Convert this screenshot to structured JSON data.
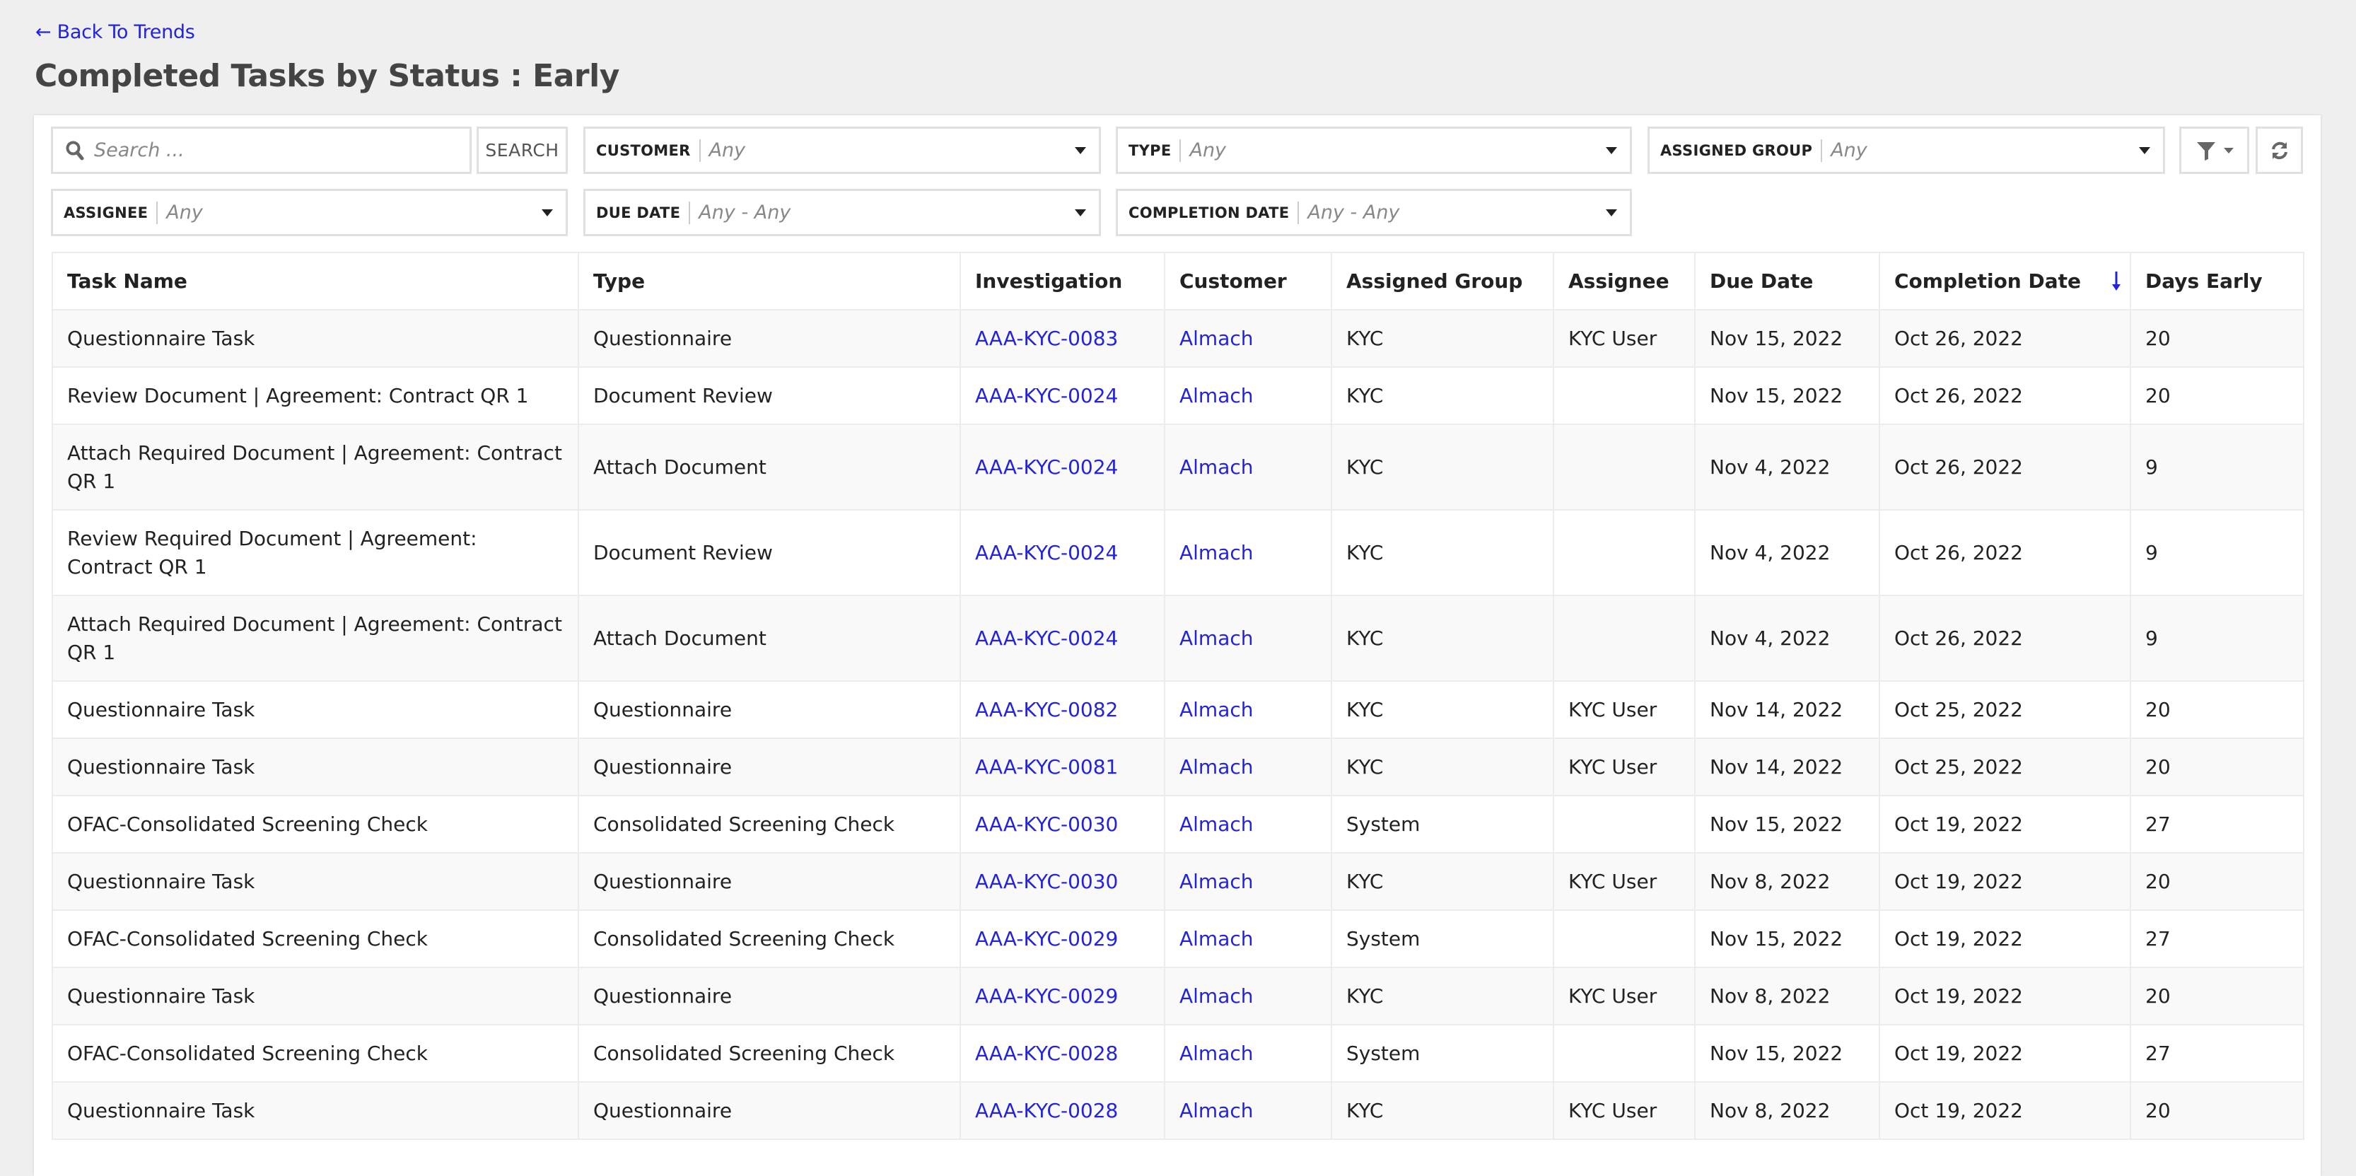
{
  "nav": {
    "back_link": "← Back To Trends"
  },
  "page": {
    "title": "Completed Tasks by Status : Early"
  },
  "filters": {
    "search": {
      "placeholder": "Search ...",
      "value": "",
      "button_label": "SEARCH",
      "icon": "search-icon"
    },
    "customer": {
      "label": "CUSTOMER",
      "value": "Any"
    },
    "type": {
      "label": "TYPE",
      "value": "Any"
    },
    "assigned_group": {
      "label": "ASSIGNED GROUP",
      "value": "Any"
    },
    "assignee": {
      "label": "ASSIGNEE",
      "value": "Any"
    },
    "due_date": {
      "label": "DUE DATE",
      "value": "Any - Any"
    },
    "completion_date": {
      "label": "COMPLETION DATE",
      "value": "Any - Any"
    },
    "filter_button_icon": "filter-icon",
    "refresh_button_icon": "refresh-icon"
  },
  "table": {
    "sorted_column": "Completion Date",
    "sort_direction": "descending",
    "columns": [
      "Task Name",
      "Type",
      "Investigation",
      "Customer",
      "Assigned Group",
      "Assignee",
      "Due Date",
      "Completion Date",
      "Days Early"
    ],
    "rows": [
      {
        "task_name": "Questionnaire Task",
        "type": "Questionnaire",
        "investigation": "AAA-KYC-0083",
        "customer": "Almach",
        "assigned_group": "KYC",
        "assignee": "KYC User",
        "due_date": "Nov 15, 2022",
        "completion_date": "Oct 26, 2022",
        "days_early": "20"
      },
      {
        "task_name": "Review Document | Agreement: Contract QR 1",
        "type": "Document Review",
        "investigation": "AAA-KYC-0024",
        "customer": "Almach",
        "assigned_group": "KYC",
        "assignee": "",
        "due_date": "Nov 15, 2022",
        "completion_date": "Oct 26, 2022",
        "days_early": "20"
      },
      {
        "task_name": "Attach Required Document | Agreement: Contract QR 1",
        "type": "Attach Document",
        "investigation": "AAA-KYC-0024",
        "customer": "Almach",
        "assigned_group": "KYC",
        "assignee": "",
        "due_date": "Nov 4, 2022",
        "completion_date": "Oct 26, 2022",
        "days_early": "9"
      },
      {
        "task_name": "Review Required Document | Agreement: Contract QR 1",
        "type": "Document Review",
        "investigation": "AAA-KYC-0024",
        "customer": "Almach",
        "assigned_group": "KYC",
        "assignee": "",
        "due_date": "Nov 4, 2022",
        "completion_date": "Oct 26, 2022",
        "days_early": "9"
      },
      {
        "task_name": "Attach Required Document | Agreement: Contract QR 1",
        "type": "Attach Document",
        "investigation": "AAA-KYC-0024",
        "customer": "Almach",
        "assigned_group": "KYC",
        "assignee": "",
        "due_date": "Nov 4, 2022",
        "completion_date": "Oct 26, 2022",
        "days_early": "9"
      },
      {
        "task_name": "Questionnaire Task",
        "type": "Questionnaire",
        "investigation": "AAA-KYC-0082",
        "customer": "Almach",
        "assigned_group": "KYC",
        "assignee": "KYC User",
        "due_date": "Nov 14, 2022",
        "completion_date": "Oct 25, 2022",
        "days_early": "20"
      },
      {
        "task_name": "Questionnaire Task",
        "type": "Questionnaire",
        "investigation": "AAA-KYC-0081",
        "customer": "Almach",
        "assigned_group": "KYC",
        "assignee": "KYC User",
        "due_date": "Nov 14, 2022",
        "completion_date": "Oct 25, 2022",
        "days_early": "20"
      },
      {
        "task_name": "OFAC-Consolidated Screening Check",
        "type": "Consolidated Screening Check",
        "investigation": "AAA-KYC-0030",
        "customer": "Almach",
        "assigned_group": "System",
        "assignee": "",
        "due_date": "Nov 15, 2022",
        "completion_date": "Oct 19, 2022",
        "days_early": "27"
      },
      {
        "task_name": "Questionnaire Task",
        "type": "Questionnaire",
        "investigation": "AAA-KYC-0030",
        "customer": "Almach",
        "assigned_group": "KYC",
        "assignee": "KYC User",
        "due_date": "Nov 8, 2022",
        "completion_date": "Oct 19, 2022",
        "days_early": "20"
      },
      {
        "task_name": "OFAC-Consolidated Screening Check",
        "type": "Consolidated Screening Check",
        "investigation": "AAA-KYC-0029",
        "customer": "Almach",
        "assigned_group": "System",
        "assignee": "",
        "due_date": "Nov 15, 2022",
        "completion_date": "Oct 19, 2022",
        "days_early": "27"
      },
      {
        "task_name": "Questionnaire Task",
        "type": "Questionnaire",
        "investigation": "AAA-KYC-0029",
        "customer": "Almach",
        "assigned_group": "KYC",
        "assignee": "KYC User",
        "due_date": "Nov 8, 2022",
        "completion_date": "Oct 19, 2022",
        "days_early": "20"
      },
      {
        "task_name": "OFAC-Consolidated Screening Check",
        "type": "Consolidated Screening Check",
        "investigation": "AAA-KYC-0028",
        "customer": "Almach",
        "assigned_group": "System",
        "assignee": "",
        "due_date": "Nov 15, 2022",
        "completion_date": "Oct 19, 2022",
        "days_early": "27"
      },
      {
        "task_name": "Questionnaire Task",
        "type": "Questionnaire",
        "investigation": "AAA-KYC-0028",
        "customer": "Almach",
        "assigned_group": "KYC",
        "assignee": "KYC User",
        "due_date": "Nov 8, 2022",
        "completion_date": "Oct 19, 2022",
        "days_early": "20"
      }
    ]
  },
  "colors": {
    "link": "#2323dd",
    "page_background": "#efefef",
    "title": "#444444",
    "row_stripe": "#f9f9f9",
    "border": "#e0e0e0"
  }
}
